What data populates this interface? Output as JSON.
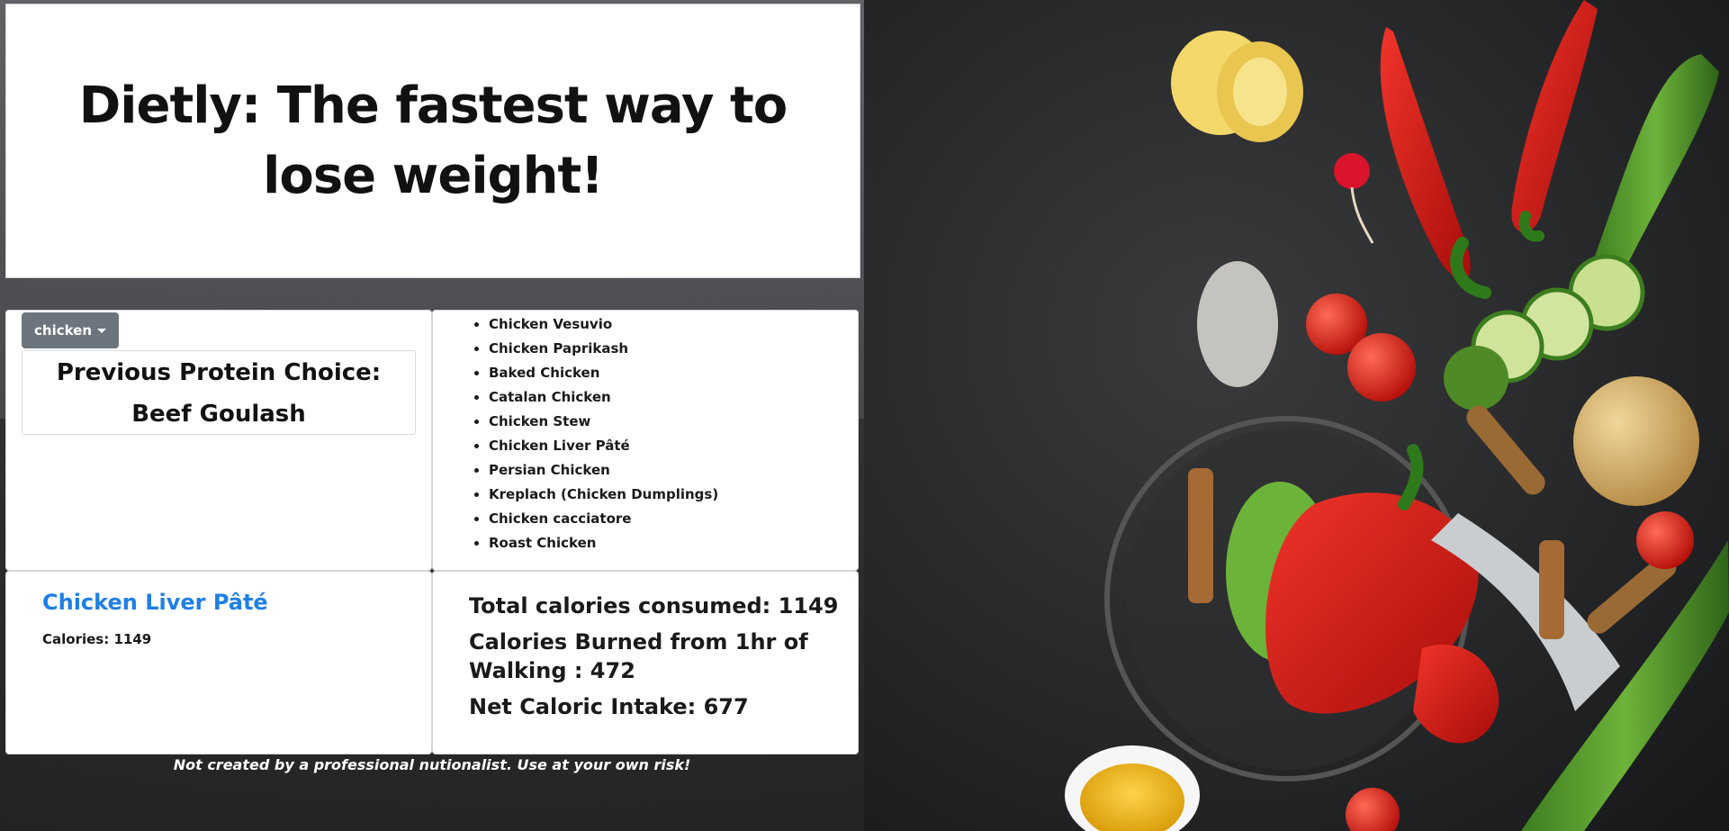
{
  "header": {
    "title": "Dietly: The fastest way to lose weight!"
  },
  "protein": {
    "dropdown_label": "chicken",
    "previous_label": "Previous Protein Choice:",
    "previous_value": "Beef Goulash"
  },
  "recipes": [
    "Chicken Vesuvio",
    "Chicken Paprikash",
    "Baked Chicken",
    "Catalan Chicken",
    "Chicken Stew",
    "Chicken Liver Pâté",
    "Persian Chicken",
    "Kreplach (Chicken Dumplings)",
    "Chicken cacciatore",
    "Roast Chicken"
  ],
  "selected": {
    "title": "Chicken Liver Pâté",
    "calories": "Calories: 1149"
  },
  "totals": {
    "consumed": "Total calories consumed: 1149",
    "burned": "Calories Burned from 1hr of Walking : 472",
    "net": "Net Caloric Intake: 677"
  },
  "footer": {
    "note": "Not created by a professional nutionalist. Use at your own risk!"
  },
  "colors": {
    "link_blue": "#1f7fe5",
    "dropdown_gray": "#6c757d",
    "background_dark": "#2a2b2d"
  },
  "background_image": {
    "icon": "vegetables-photo"
  }
}
